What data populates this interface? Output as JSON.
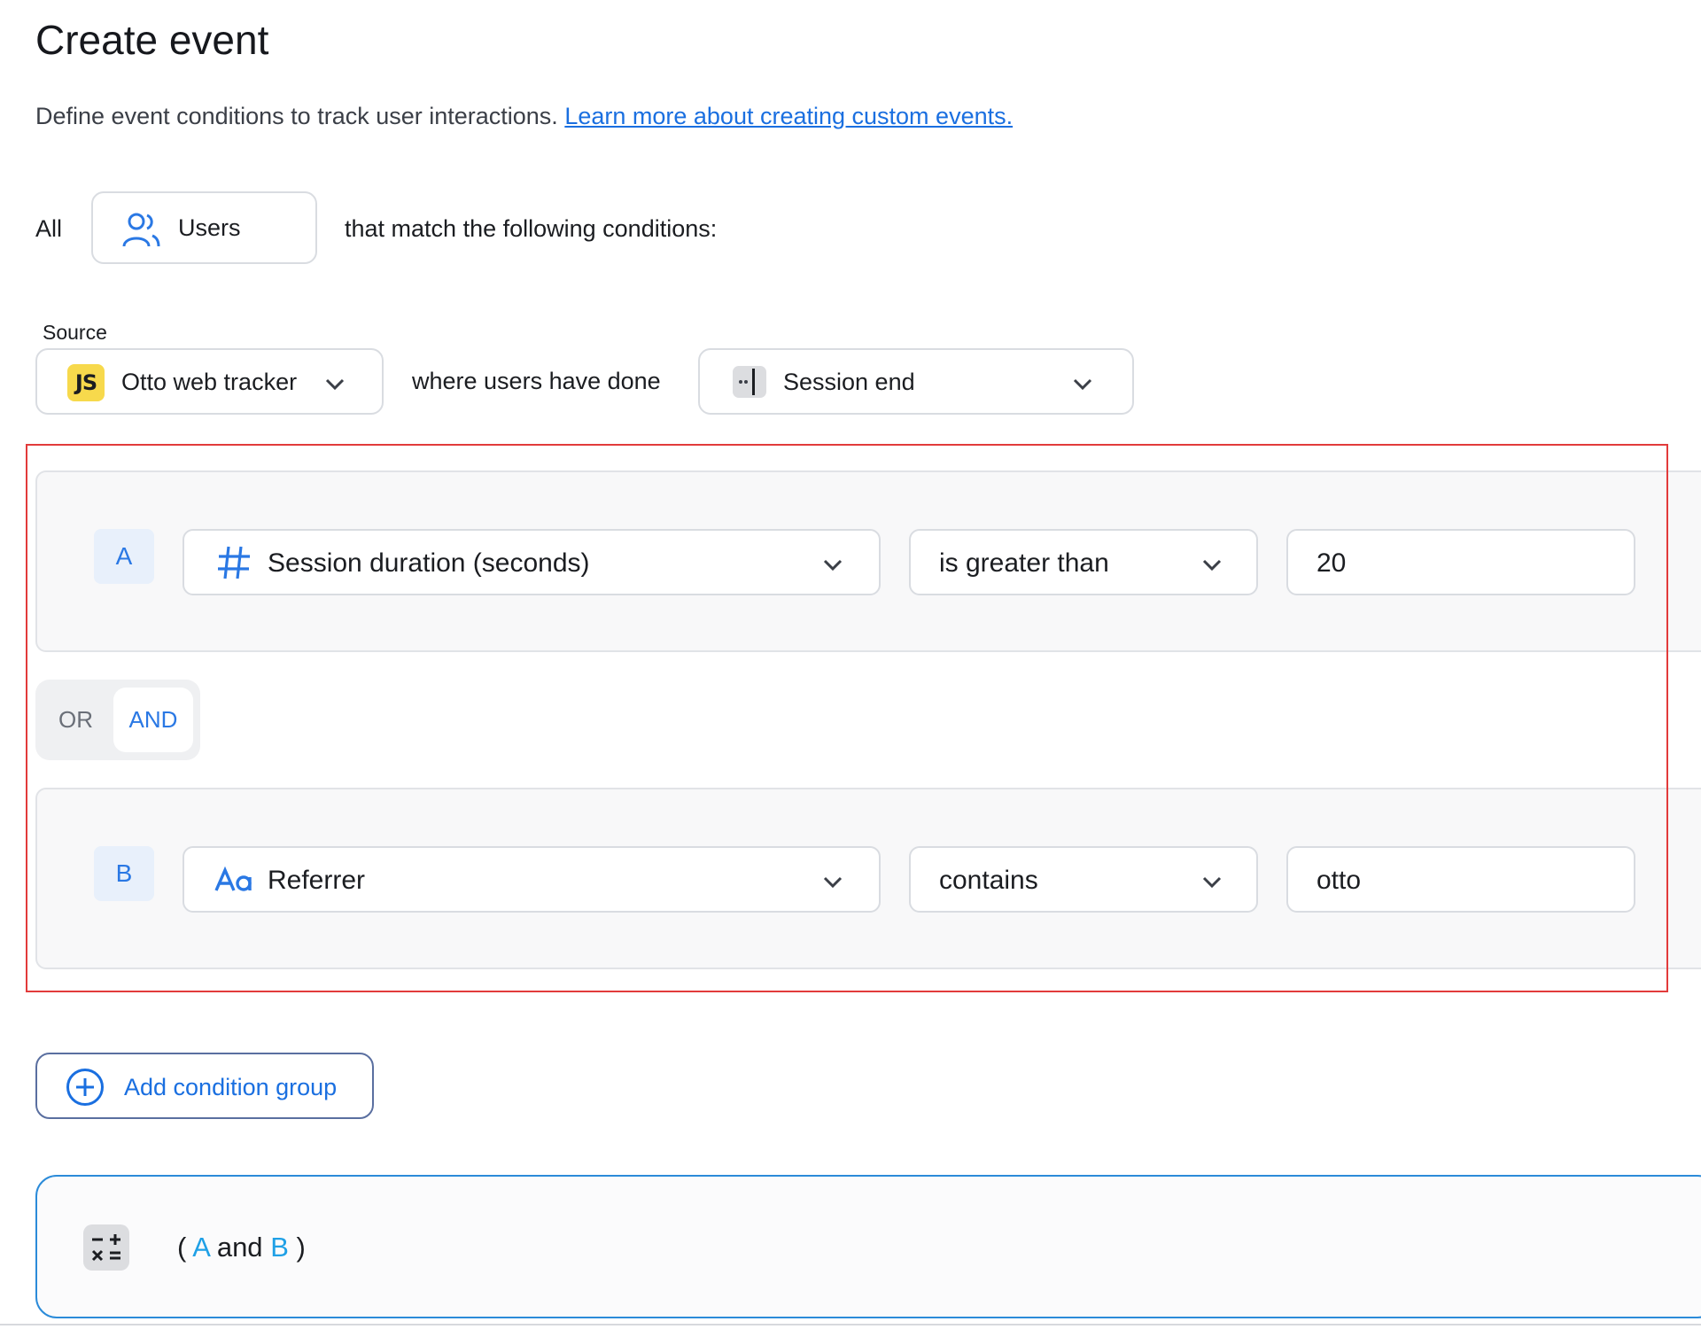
{
  "page": {
    "title": "Create event",
    "description": "Define event conditions to track user interactions.",
    "learn_more_link": "Learn more about creating custom events."
  },
  "audience": {
    "prefix": "All",
    "entity": "Users",
    "suffix": "that match the following conditions:"
  },
  "source": {
    "label": "Source",
    "selected": "Otto web tracker",
    "badge": "JS",
    "connector": "where users have done",
    "event": "Session end"
  },
  "conditions": {
    "groups": [
      {
        "letter": "A",
        "property": "Session duration (seconds)",
        "property_icon": "hash-icon",
        "operator": "is greater than",
        "value": "20"
      },
      {
        "letter": "B",
        "property": "Referrer",
        "property_icon": "text-type-icon",
        "operator": "contains",
        "value": "otto"
      }
    ],
    "logic_toggle": {
      "options": [
        "OR",
        "AND"
      ],
      "selected": "AND"
    },
    "add_group_label": "Add condition group"
  },
  "formula": {
    "open": "(",
    "ref_a": "A",
    "joiner": "and",
    "ref_b": "B",
    "close": ")"
  },
  "colors": {
    "accent": "#1a6fe0",
    "highlight_border": "#e23b3b",
    "js_badge": "#f7d94c",
    "formula_border": "#2b8bd9"
  }
}
